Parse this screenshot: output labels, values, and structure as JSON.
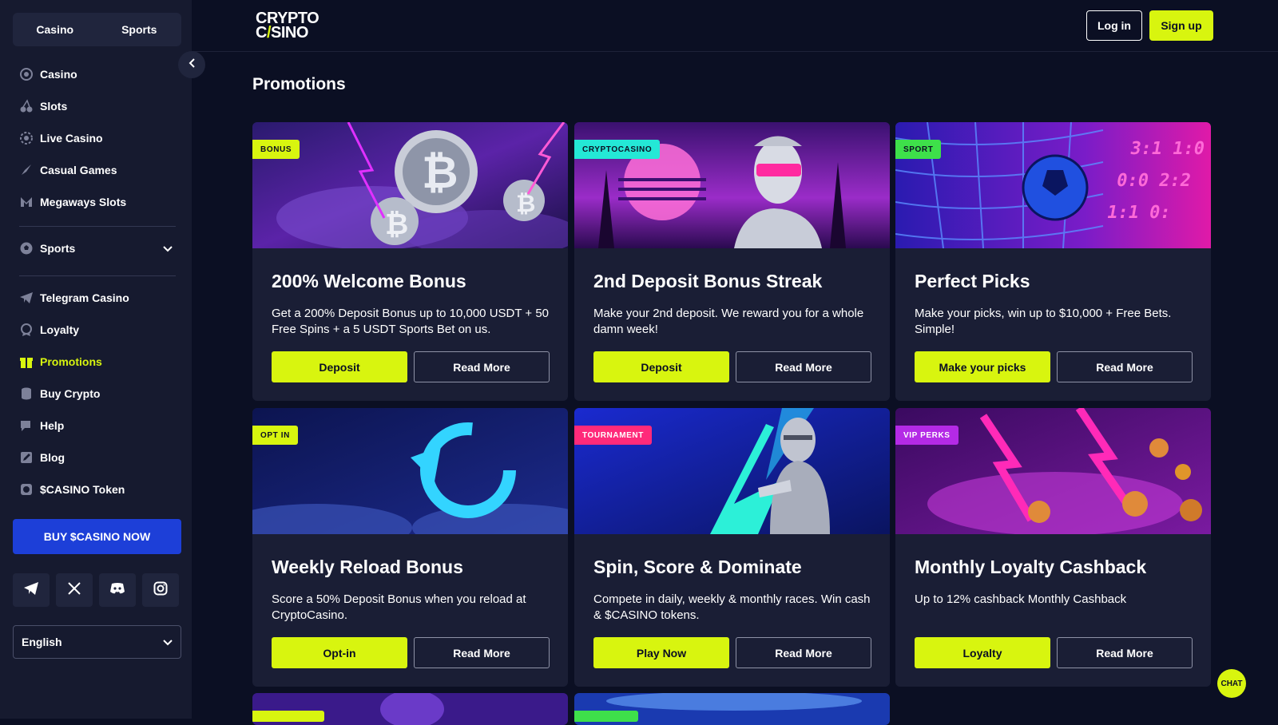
{
  "sidebar": {
    "tabs": [
      {
        "label": "Casino"
      },
      {
        "label": "Sports"
      }
    ],
    "nav": [
      {
        "label": "Casino",
        "icon": "casino-chip-icon"
      },
      {
        "label": "Slots",
        "icon": "cherry-icon"
      },
      {
        "label": "Live Casino",
        "icon": "live-chip-icon"
      },
      {
        "label": "Casual Games",
        "icon": "rocket-icon"
      },
      {
        "label": "Megaways Slots",
        "icon": "megaways-icon"
      },
      {
        "label": "Sports",
        "icon": "soccer-ball-icon"
      },
      {
        "label": "Telegram Casino",
        "icon": "telegram-icon"
      },
      {
        "label": "Loyalty",
        "icon": "medal-icon"
      },
      {
        "label": "Promotions",
        "icon": "gift-icon"
      },
      {
        "label": "Buy Crypto",
        "icon": "coins-icon"
      },
      {
        "label": "Help",
        "icon": "help-icon"
      },
      {
        "label": "Blog",
        "icon": "pencil-icon"
      },
      {
        "label": "$CASINO Token",
        "icon": "token-icon"
      }
    ],
    "active": "Promotions",
    "buy_button": "BUY $CASINO NOW",
    "socials": [
      "telegram-icon",
      "x-icon",
      "discord-icon",
      "instagram-icon"
    ],
    "language": "English"
  },
  "header": {
    "logo_line1": "CRYPTO",
    "logo_line2_a": "C",
    "logo_line2_bolt": "/",
    "logo_line2_b": "SINO",
    "login": "Log in",
    "signup": "Sign up"
  },
  "page": {
    "title": "Promotions"
  },
  "colors": {
    "accent": "#d8f50f",
    "buy": "#1d3fd8",
    "bg": "#0b0f23",
    "card": "#1a1e35"
  },
  "cards": [
    {
      "tag": "BONUS",
      "tag_color": "#d8f50f",
      "title": "200% Welcome Bonus",
      "desc": "Get a 200% Deposit Bonus up to 10,000 USDT + 50 Free Spins + a 5 USDT Sports Bet on us.",
      "primary": "Deposit",
      "secondary": "Read More"
    },
    {
      "tag": "CRYPTOCASINO",
      "tag_color": "#24e8d6",
      "title": "2nd Deposit Bonus Streak",
      "desc": "Make your 2nd deposit. We reward you for a whole damn week!",
      "primary": "Deposit",
      "secondary": "Read More"
    },
    {
      "tag": "SPORT",
      "tag_color": "#3ee04a",
      "title": "Perfect Picks",
      "desc": "Make your picks, win up to $10,000 + Free Bets. Simple!",
      "primary": "Make your picks",
      "secondary": "Read More"
    },
    {
      "tag": "OPT IN",
      "tag_color": "#d8f50f",
      "title": "Weekly Reload Bonus",
      "desc": "Score a 50% Deposit Bonus when you reload at CryptoCasino.",
      "primary": "Opt-in",
      "secondary": "Read More"
    },
    {
      "tag": "TOURNAMENT",
      "tag_color": "#ff2a7a",
      "title": "Spin, Score & Dominate",
      "desc": "Compete in daily, weekly & monthly races. Win cash & $CASINO tokens.",
      "primary": "Play Now",
      "secondary": "Read More"
    },
    {
      "tag": "VIP PERKS",
      "tag_color": "#b42ae6",
      "title": "Monthly Loyalty Cashback",
      "desc": "Up to 12% cashback Monthly Cashback",
      "primary": "Loyalty",
      "secondary": "Read More"
    }
  ],
  "chat": "CHAT"
}
